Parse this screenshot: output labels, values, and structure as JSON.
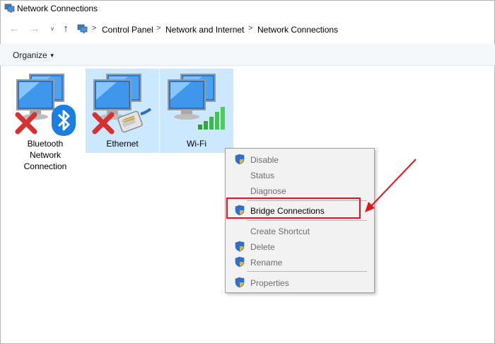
{
  "window": {
    "title": "Network Connections"
  },
  "address_bar": {
    "breadcrumbs": [
      "Control Panel",
      "Network and Internet",
      "Network Connections"
    ]
  },
  "command_bar": {
    "organize_label": "Organize"
  },
  "connections": [
    {
      "label_lines": [
        "Bluetooth",
        "Network",
        "Connection"
      ],
      "status": "disconnected",
      "selected": false
    },
    {
      "label_lines": [
        "Ethernet"
      ],
      "status": "disconnected",
      "selected": true
    },
    {
      "label_lines": [
        "Wi-Fi"
      ],
      "status": "connected",
      "selected": true
    }
  ],
  "context_menu": {
    "items": [
      {
        "label": "Disable",
        "shield": true,
        "enabled": false
      },
      {
        "label": "Status",
        "shield": false,
        "enabled": false
      },
      {
        "label": "Diagnose",
        "shield": false,
        "enabled": false
      },
      {
        "label": "Bridge Connections",
        "shield": true,
        "enabled": true
      },
      {
        "label": "Create Shortcut",
        "shield": false,
        "enabled": false
      },
      {
        "label": "Delete",
        "shield": true,
        "enabled": false
      },
      {
        "label": "Rename",
        "shield": true,
        "enabled": false
      },
      {
        "label": "Properties",
        "shield": true,
        "enabled": false
      }
    ]
  },
  "colors": {
    "selection": "#cce8ff",
    "highlight": "#e8141b",
    "menu_bg": "#f2f2f2"
  },
  "icons": [
    "network-app-icon",
    "back-arrow-icon",
    "forward-arrow-icon",
    "up-arrow-icon",
    "monitor-icon",
    "bluetooth-icon",
    "ethernet-plug-icon",
    "wifi-signal-icon",
    "red-x-icon",
    "uac-shield-icon"
  ]
}
